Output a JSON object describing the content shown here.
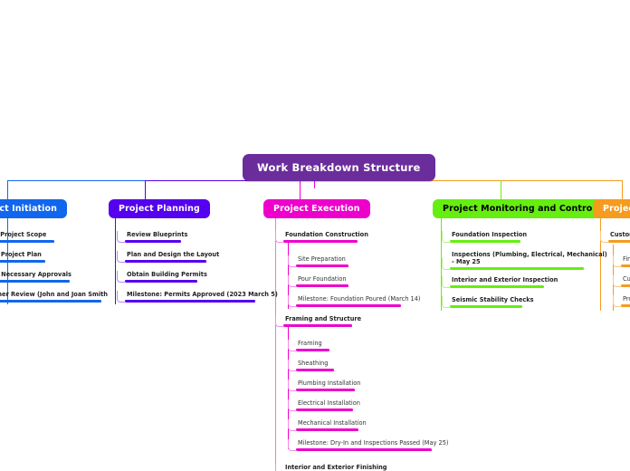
{
  "diagram": {
    "type": "mind-map",
    "root": {
      "label": "Work Breakdown Structure",
      "color": "#6B2D9B",
      "text_color": "#ffffff"
    },
    "trunk_colors": {
      "initiation": "#1166EE",
      "planning": "#5500EE",
      "execution": "#EE00CC",
      "monitoring": "#66EE11",
      "closure": "#F59B1E"
    },
    "branches": [
      {
        "id": "initiation",
        "label": "Project Initiation",
        "color": "#1166EE",
        "text_color": "#ffffff",
        "clipped": true,
        "items": [
          {
            "label": "Define Project Scope",
            "level": 1
          },
          {
            "label": "Create Project Plan",
            "level": 1
          },
          {
            "label": "Obtain Necessary Approvals",
            "level": 1
          },
          {
            "label": "Customer Review (John and Joan Smith",
            "level": 1
          }
        ]
      },
      {
        "id": "planning",
        "label": "Project Planning",
        "color": "#5500EE",
        "text_color": "#ffffff",
        "items": [
          {
            "label": "Review Blueprints",
            "level": 1
          },
          {
            "label": "Plan and Design the Layout",
            "level": 1
          },
          {
            "label": "Obtain Building Permits",
            "level": 1
          },
          {
            "label": "Milestone: Permits Approved (2023 March 5)",
            "level": 1
          }
        ]
      },
      {
        "id": "execution",
        "label": "Project Execution",
        "color": "#EE00CC",
        "text_color": "#ffffff",
        "items": [
          {
            "label": "Foundation Construction",
            "level": 1
          },
          {
            "label": "Site Preparation",
            "level": 2
          },
          {
            "label": "Pour Foundation",
            "level": 2
          },
          {
            "label": "Milestone: Foundation Poured (March 14)",
            "level": 2
          },
          {
            "label": "Framing and Structure",
            "level": 1
          },
          {
            "label": "Framing",
            "level": 2
          },
          {
            "label": "Sheathing",
            "level": 2
          },
          {
            "label": "Plumbing Installation",
            "level": 2
          },
          {
            "label": "Electrical Installation",
            "level": 2
          },
          {
            "label": "Mechanical Installation",
            "level": 2
          },
          {
            "label": "Milestone: Dry-In and Inspections Passed (May 25)",
            "level": 2
          },
          {
            "label": "Interior and Exterior Finishing",
            "level": 1
          }
        ]
      },
      {
        "id": "monitoring",
        "label": "Project Monitoring and Controlling",
        "color": "#66EE11",
        "text_color": "#000000",
        "items": [
          {
            "label": "Foundation Inspection",
            "level": 1
          },
          {
            "label": "Inspections (Plumbing, Electrical, Mechanical)\n- May 25",
            "level": 1
          },
          {
            "label": "Interior and Exterior Inspection",
            "level": 1
          },
          {
            "label": "Seismic Stability Checks",
            "level": 1
          }
        ]
      },
      {
        "id": "closure",
        "label": "Project Cl",
        "color": "#F59B1E",
        "text_color": "#ffffff",
        "clipped": true,
        "items": [
          {
            "label": "Customer",
            "level": 1
          },
          {
            "label": "Fina",
            "level": 2
          },
          {
            "label": "Cus",
            "level": 2
          },
          {
            "label": "Proj",
            "level": 2
          }
        ]
      }
    ]
  }
}
